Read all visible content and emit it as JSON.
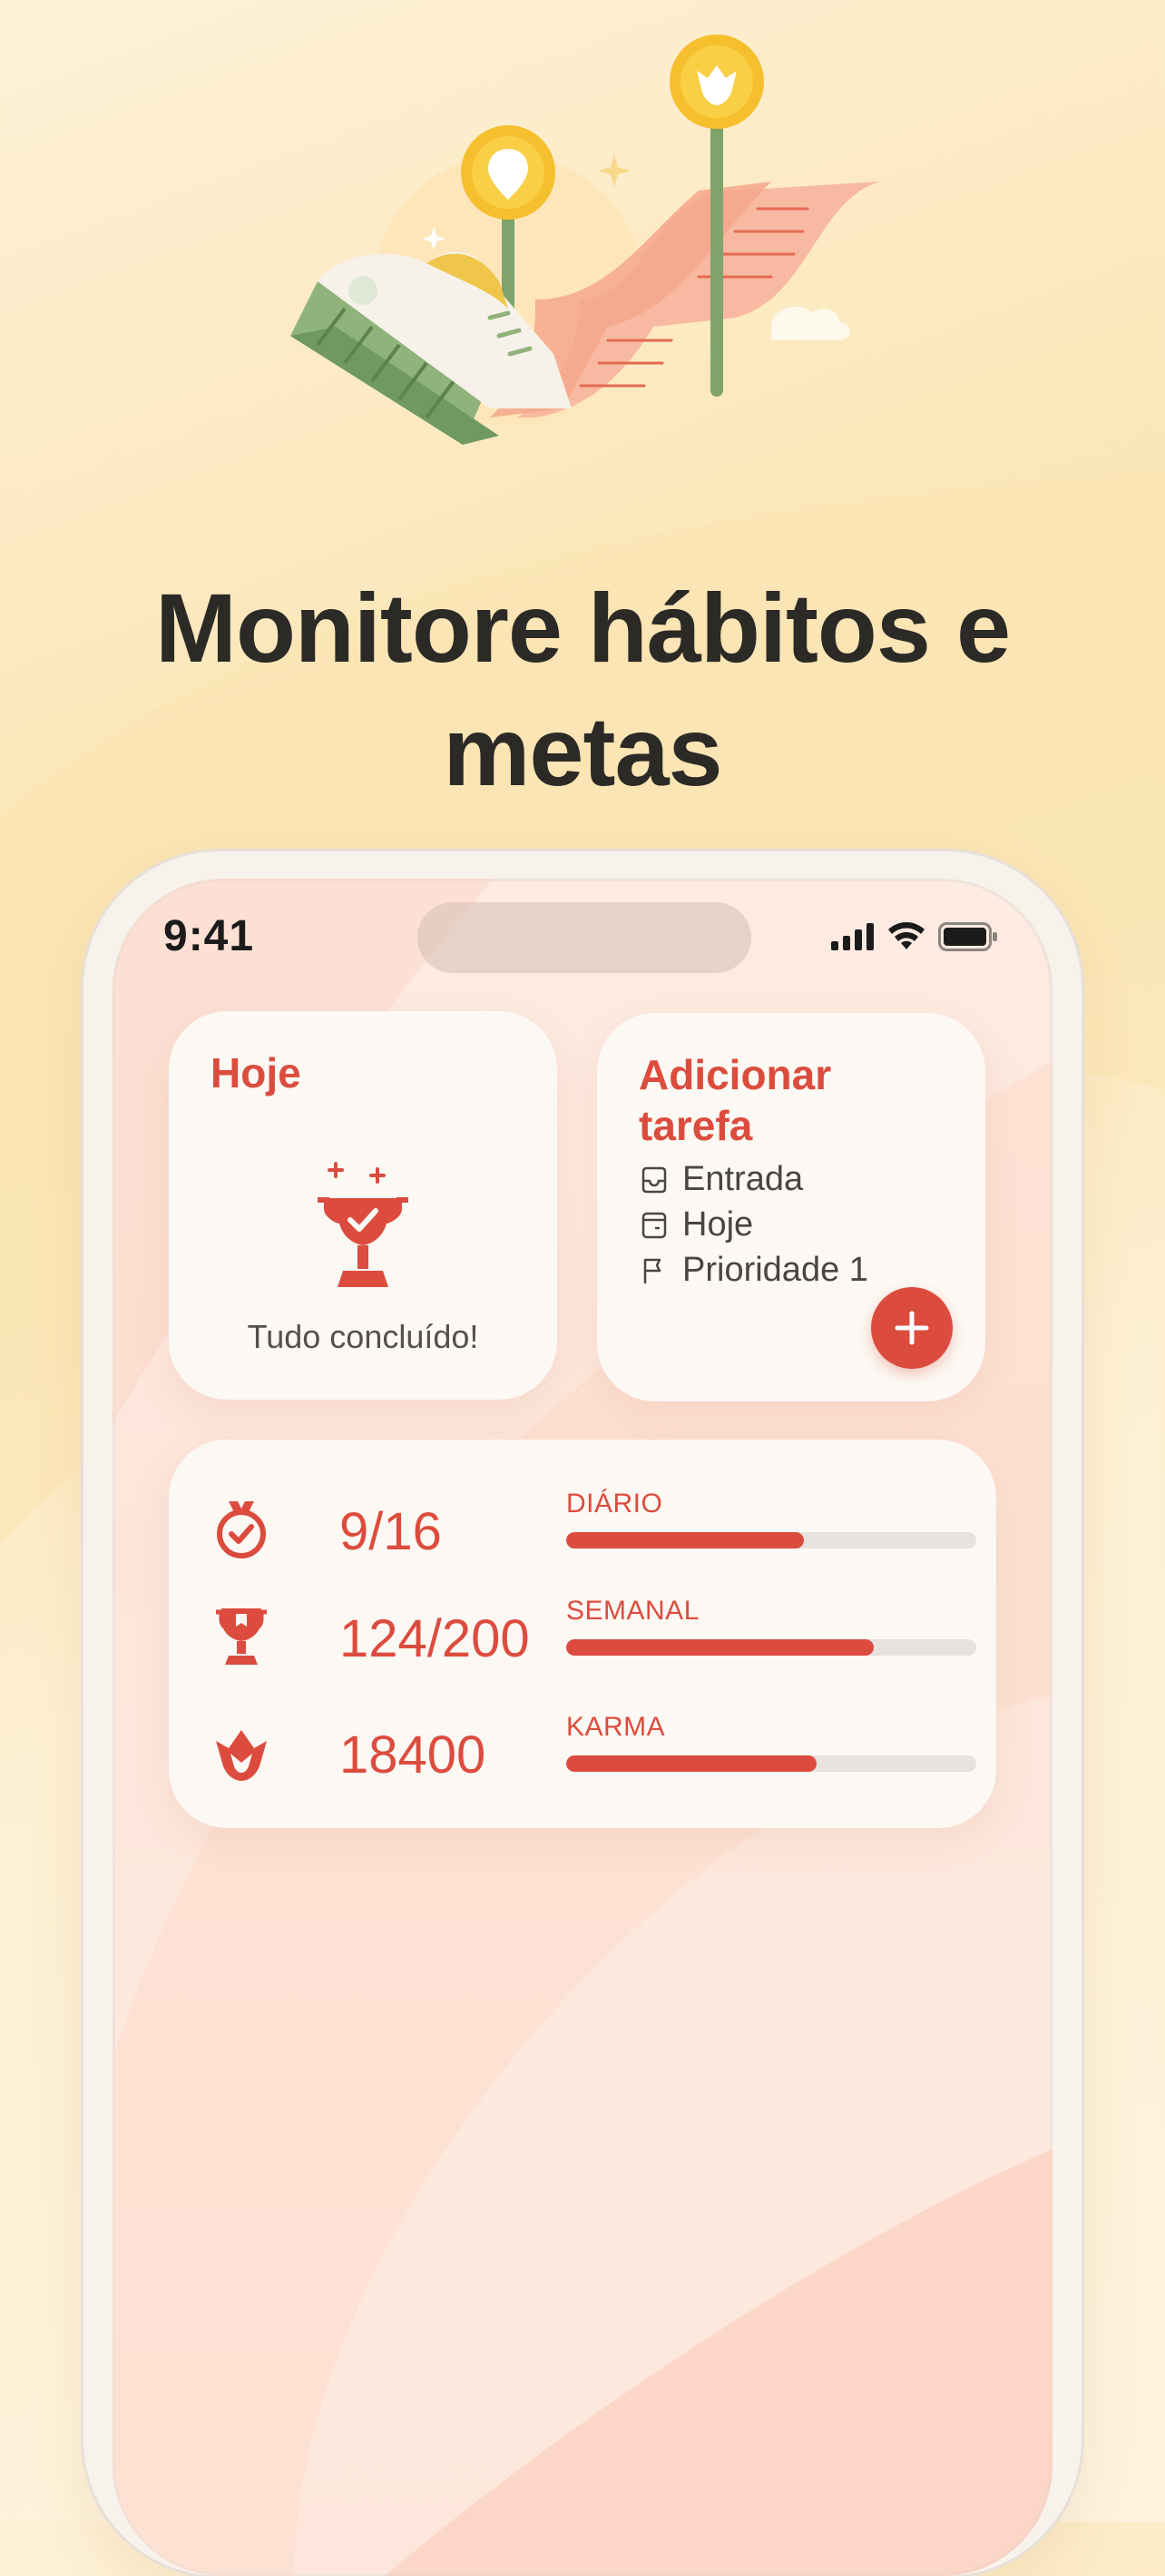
{
  "headline": {
    "line1": "Monitore hábitos e",
    "line2": "metas"
  },
  "status_bar": {
    "time": "9:41"
  },
  "widget_today": {
    "title": "Hoje",
    "message": "Tudo concluído!",
    "icon": "trophy-icon"
  },
  "widget_add": {
    "title": "Adicionar tarefa",
    "rows": [
      {
        "label": "Entrada",
        "icon": "inbox-icon"
      },
      {
        "label": "Hoje",
        "icon": "calendar-icon"
      },
      {
        "label": "Prioridade 1",
        "icon": "flag-icon"
      }
    ],
    "fab_icon": "plus-icon"
  },
  "widget_stats": {
    "rows": [
      {
        "value": "9/16",
        "label": "DIÁRIO",
        "progress": 0.58,
        "icon": "medal-icon"
      },
      {
        "value": "124/200",
        "label": "SEMANAL",
        "progress": 0.75,
        "icon": "trophy-icon"
      },
      {
        "value": "18400",
        "label": "KARMA",
        "progress": 0.61,
        "icon": "karma-icon"
      }
    ]
  },
  "colors": {
    "accent": "#dc4c3e",
    "headline": "#2c2a26",
    "widget_bg": "#fcf8f3",
    "track": "#e6e2dd"
  }
}
